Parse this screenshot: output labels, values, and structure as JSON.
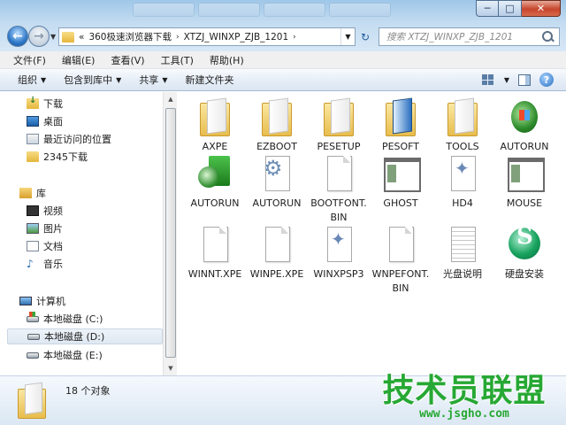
{
  "window": {
    "min_glyph": "─",
    "max_glyph": "□",
    "close_glyph": "✕"
  },
  "address": {
    "prefix": "«",
    "segments": [
      "360极速浏览器下载",
      "XTZJ_WINXP_ZJB_1201"
    ],
    "separator": "›"
  },
  "search": {
    "placeholder": "搜索 XTZJ_WINXP_ZJB_1201"
  },
  "menu": [
    "文件(F)",
    "编辑(E)",
    "查看(V)",
    "工具(T)",
    "帮助(H)"
  ],
  "commands": [
    "组织",
    "包含到库中",
    "共享",
    "新建文件夹"
  ],
  "nav": {
    "favorites": [
      {
        "label": "下载",
        "icon": "folder-download-icon"
      },
      {
        "label": "桌面",
        "icon": "desktop-icon"
      },
      {
        "label": "最近访问的位置",
        "icon": "recent-places-icon"
      },
      {
        "label": "2345下载",
        "icon": "folder-icon"
      }
    ],
    "libraries_label": "库",
    "libraries": [
      {
        "label": "视频",
        "icon": "video-library-icon"
      },
      {
        "label": "图片",
        "icon": "pictures-library-icon"
      },
      {
        "label": "文档",
        "icon": "documents-library-icon"
      },
      {
        "label": "音乐",
        "icon": "music-library-icon"
      }
    ],
    "computer_label": "计算机",
    "drives": [
      {
        "label": "本地磁盘 (C:)",
        "icon": "system-drive-icon"
      },
      {
        "label": "本地磁盘 (D:)",
        "icon": "drive-icon",
        "selected": true
      },
      {
        "label": "本地磁盘 (E:)",
        "icon": "drive-icon"
      }
    ]
  },
  "files": [
    {
      "name": "AXPE",
      "icon": "folder-icon"
    },
    {
      "name": "EZBOOT",
      "icon": "folder-icon"
    },
    {
      "name": "PESETUP",
      "icon": "folder-icon"
    },
    {
      "name": "PESOFT",
      "icon": "folder-blue-icon"
    },
    {
      "name": "TOOLS",
      "icon": "folder-icon"
    },
    {
      "name": "AUTORUN",
      "icon": "autorun-app-icon"
    },
    {
      "name": "AUTORUN",
      "icon": "autorun-inf-icon"
    },
    {
      "name": "AUTORUN",
      "icon": "settings-file-icon"
    },
    {
      "name": "BOOTFONT.BIN",
      "icon": "blank-file-icon"
    },
    {
      "name": "GHOST",
      "icon": "window-app-icon"
    },
    {
      "name": "HD4",
      "icon": "shell-file-icon"
    },
    {
      "name": "MOUSE",
      "icon": "window-app-icon"
    },
    {
      "name": "WINNT.XPE",
      "icon": "blank-file-icon"
    },
    {
      "name": "WINPE.XPE",
      "icon": "blank-file-icon"
    },
    {
      "name": "WINXPSP3",
      "icon": "shell-file-icon"
    },
    {
      "name": "WNPEFONT.BIN",
      "icon": "blank-file-icon"
    },
    {
      "name": "光盘说明",
      "icon": "text-file-icon"
    },
    {
      "name": "硬盘安装",
      "icon": "installer-disk-icon"
    }
  ],
  "status": {
    "count": "18 个对象"
  },
  "watermark": {
    "title": "技术员联盟",
    "url": "www.jsgho.com"
  }
}
